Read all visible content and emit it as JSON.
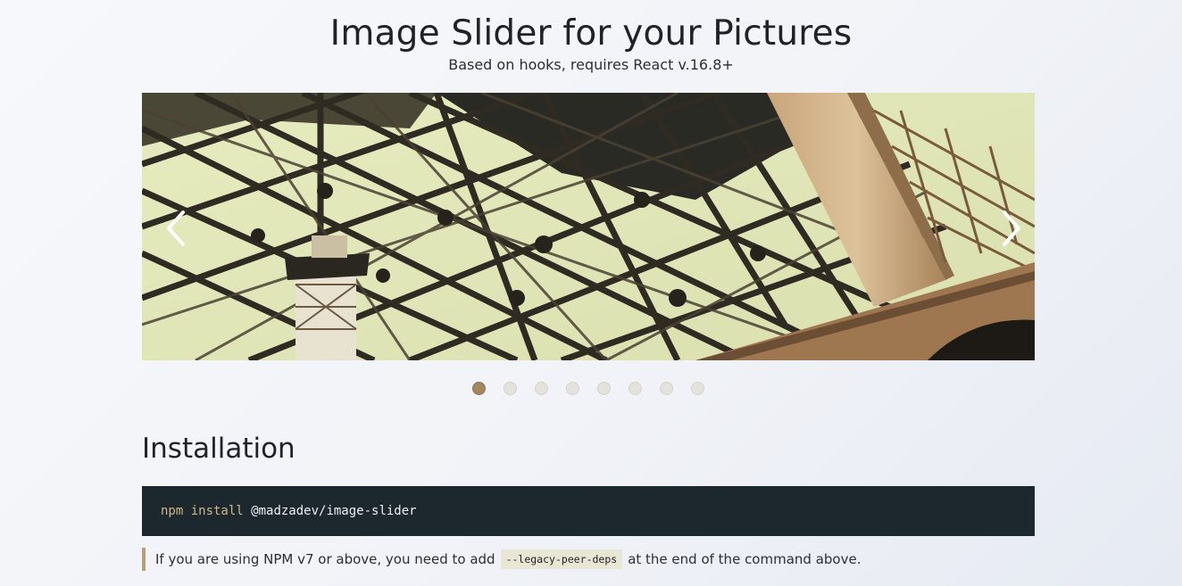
{
  "header": {
    "title": "Image Slider for your Pictures",
    "subtitle": "Based on hooks, requires React v.16.8+"
  },
  "slider": {
    "image_description": "bridge-steel-truss-photo",
    "prev_icon": "chevron-left-icon",
    "next_icon": "chevron-right-icon",
    "slide_count": 8,
    "active_index": 0
  },
  "installation": {
    "heading": "Installation",
    "command": "npm install",
    "package": "@madzadev/image-slider",
    "note_before": "If you are using NPM v7 or above, you need to add",
    "note_code": "--legacy-peer-deps",
    "note_after": "at the end of the command above."
  },
  "colors": {
    "dot_active": "#a1865e",
    "dot_inactive": "#e4e2dc",
    "code_background": "#1d272e",
    "note_accent": "#b8a078"
  }
}
